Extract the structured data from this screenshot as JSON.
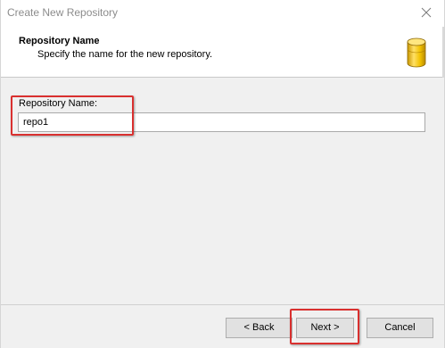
{
  "window": {
    "title": "Create New Repository"
  },
  "header": {
    "title": "Repository Name",
    "subtitle": "Specify the name for the new repository.",
    "icon": "database-icon",
    "icon_color": "#f2c200"
  },
  "form": {
    "repository_name_label": "Repository Name:",
    "repository_name_value": "repo1"
  },
  "buttons": {
    "back_label": "< Back",
    "next_label": "Next >",
    "cancel_label": "Cancel"
  },
  "annotations": {
    "highlight_color": "#d9302f"
  }
}
